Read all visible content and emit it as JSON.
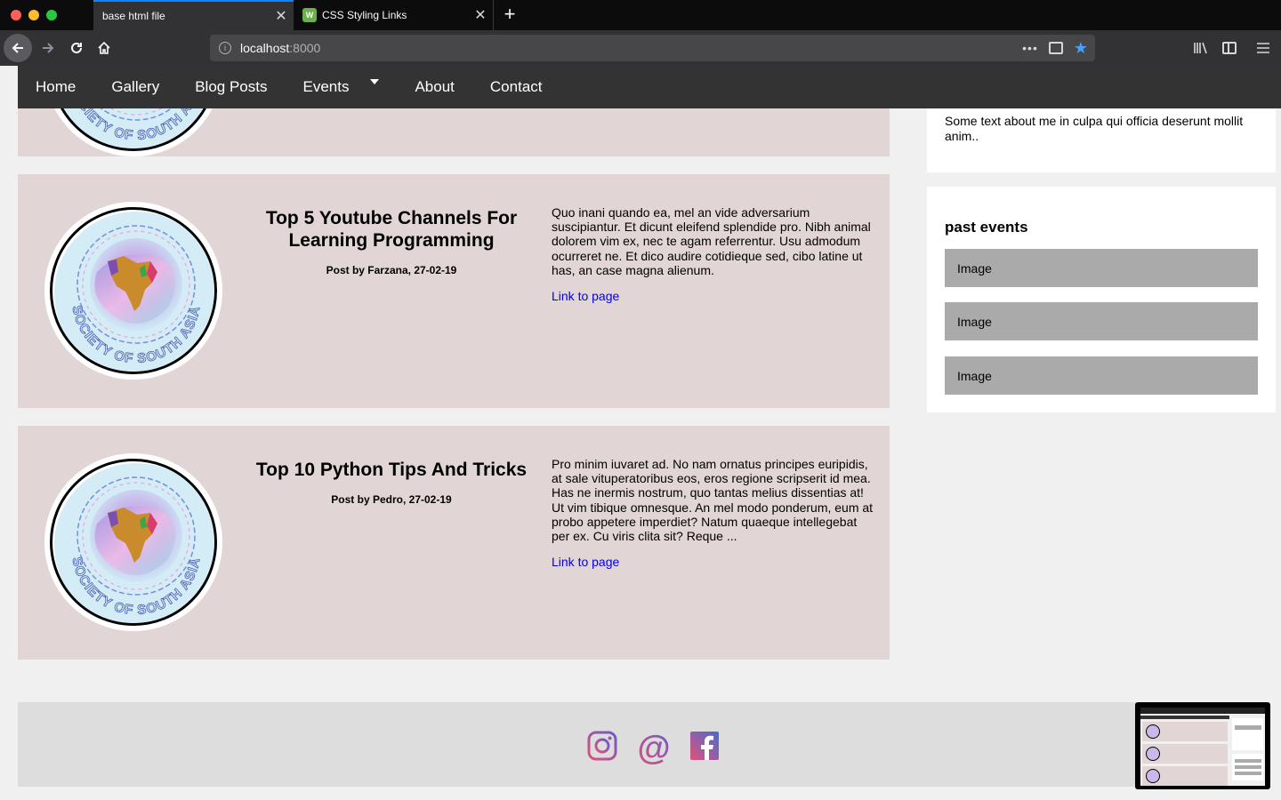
{
  "browser": {
    "tabs": [
      {
        "title": "base html file",
        "active": true
      },
      {
        "title": "CSS Styling Links",
        "active": false,
        "favicon": "css-icon"
      }
    ],
    "url_host": "localhost",
    "url_port": ":8000"
  },
  "site_nav": {
    "items": [
      "Home",
      "Gallery",
      "Blog Posts",
      "Events",
      "About",
      "Contact"
    ]
  },
  "posts": [
    {
      "title": "Top 5 Youtube Channels For Learning Programming",
      "byline": "Post by Farzana, 27-02-19",
      "body": "Quo inani quando ea, mel an vide adversarium suscipiantur. Et dicunt eleifend splendide pro. Nibh animal dolorem vim ex, nec te agam referrentur. Usu admodum ocurreret ne. Et dico audire cotidieque sed, cibo latine ut has, an case magna alienum.",
      "link": "Link to page"
    },
    {
      "title": "Top 10 Python Tips And Tricks",
      "byline": "Post by Pedro, 27-02-19",
      "body": "Pro minim iuvaret ad. No nam ornatus principes euripidis, at sale vituperatoribus eos, eros regione scripserit id mea. Has ne inermis nostrum, quo tantas melius dissentias at! Ut vim tibique omnesque. An mel modo ponderum, eum at probo appetere imperdiet? Natum quaeque intellegebat per ex. Cu viris clita sit? Reque ...",
      "link": "Link to page"
    }
  ],
  "avatar": {
    "logo_text": "SOCIETY OF SOUTH ASIA"
  },
  "sidebar": {
    "about_text": "Some text about me in culpa qui officia deserunt mollit anim..",
    "events_title": "past events",
    "images": [
      "Image",
      "Image",
      "Image"
    ]
  },
  "footer": {
    "icons": [
      "instagram-icon",
      "email-icon",
      "facebook-icon"
    ]
  },
  "colors": {
    "card_bg": "#e2d5d5",
    "nav_bg": "#333333",
    "link": "#0000ee",
    "tab_accent": "#0a84ff"
  }
}
